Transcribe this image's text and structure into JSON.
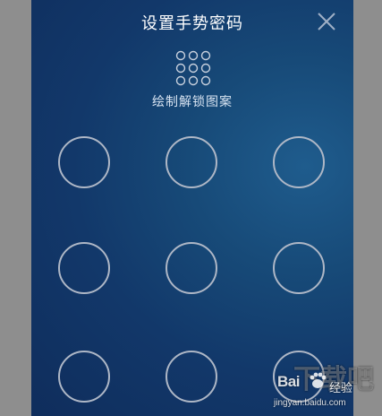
{
  "header": {
    "title": "设置手势密码",
    "close_icon": "close-icon"
  },
  "preview": {
    "icon": "pattern-preview-icon",
    "rows": 3,
    "cols": 3
  },
  "instruction": "绘制解锁图案",
  "pattern_grid": {
    "rows": 3,
    "cols": 3,
    "nodes": [
      1,
      2,
      3,
      4,
      5,
      6,
      7,
      8,
      9
    ]
  },
  "watermark": {
    "big_text": "下载吧",
    "logo_text": "Bai",
    "jingyan": "经验",
    "url": "jingyan.baidu.com"
  },
  "colors": {
    "background_top": "#0f2d5c",
    "background_glow": "#1f5c8d",
    "ring": "#aeb7c6",
    "title": "#ffffff"
  }
}
